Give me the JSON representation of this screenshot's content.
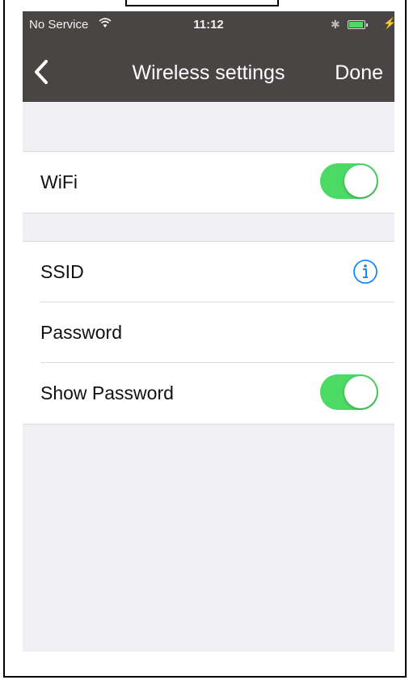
{
  "status_bar": {
    "carrier": "No Service",
    "time": "11:12",
    "wifi_icon": "wifi-icon",
    "bluetooth_icon": "bluetooth-icon",
    "battery_icon": "battery-icon",
    "charging_icon": "charging-icon"
  },
  "navbar": {
    "title": "Wireless settings",
    "done_label": "Done",
    "back_icon": "chevron-left-icon",
    "background_color": "#4a4545"
  },
  "wifi_group": {
    "wifi_label": "WiFi",
    "wifi_toggle_on": true
  },
  "network_group": {
    "ssid_label": "SSID",
    "ssid_info_icon": "info-icon",
    "password_label": "Password",
    "show_password_label": "Show Password",
    "show_password_toggle_on": true
  },
  "colors": {
    "toggle_on": "#4cd964",
    "info_accent": "#007aff",
    "background": "#efeff4"
  }
}
